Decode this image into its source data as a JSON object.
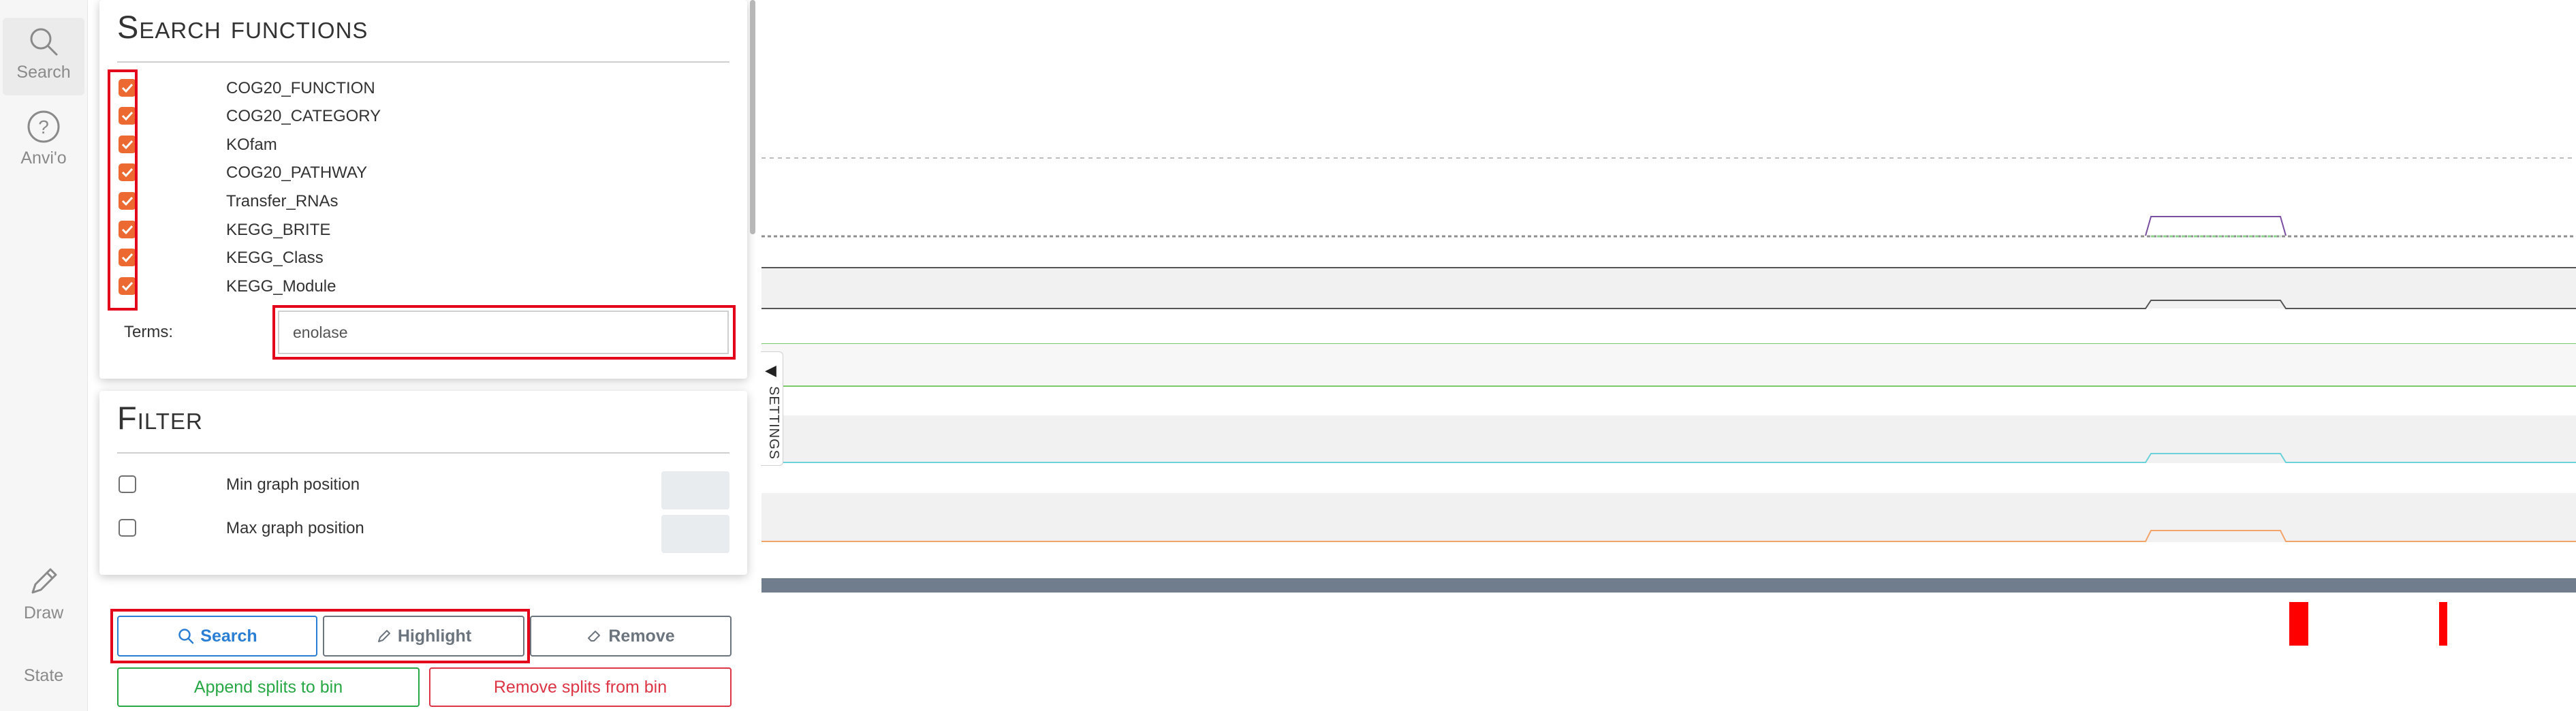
{
  "sidebar": {
    "items": [
      {
        "label": "Search",
        "icon": "search-icon"
      },
      {
        "label": "Anvi'o",
        "icon": "help-icon"
      },
      {
        "label": "Draw",
        "icon": "pencil-icon"
      },
      {
        "label": "State",
        "icon": ""
      }
    ]
  },
  "search_panel": {
    "title": "Search functions",
    "sources": [
      {
        "label": "COG20_FUNCTION",
        "checked": true
      },
      {
        "label": "COG20_CATEGORY",
        "checked": true
      },
      {
        "label": "KOfam",
        "checked": true
      },
      {
        "label": "COG20_PATHWAY",
        "checked": true
      },
      {
        "label": "Transfer_RNAs",
        "checked": true
      },
      {
        "label": "KEGG_BRITE",
        "checked": true
      },
      {
        "label": "KEGG_Class",
        "checked": true
      },
      {
        "label": "KEGG_Module",
        "checked": true
      }
    ],
    "terms_label": "Terms:",
    "terms_value": "enolase"
  },
  "filter_panel": {
    "title": "Filter",
    "options": [
      {
        "label": "Min graph position",
        "checked": false
      },
      {
        "label": "Max graph position",
        "checked": false
      }
    ]
  },
  "buttons": {
    "search": "Search",
    "highlight": "Highlight",
    "remove": "Remove",
    "append": "Append splits to bin",
    "remove_splits": "Remove splits from bin"
  },
  "settings_tab": {
    "arrow": "◀",
    "label": "SETTINGS"
  },
  "colors": {
    "accent_orange": "#ec6a31",
    "highlight_red": "#e2001a",
    "search_blue": "#2a7fd4",
    "append_green": "#28a745",
    "remove_red": "#dc3545",
    "track_bar": "#6f7d8c",
    "marker_red": "#ff0000"
  }
}
